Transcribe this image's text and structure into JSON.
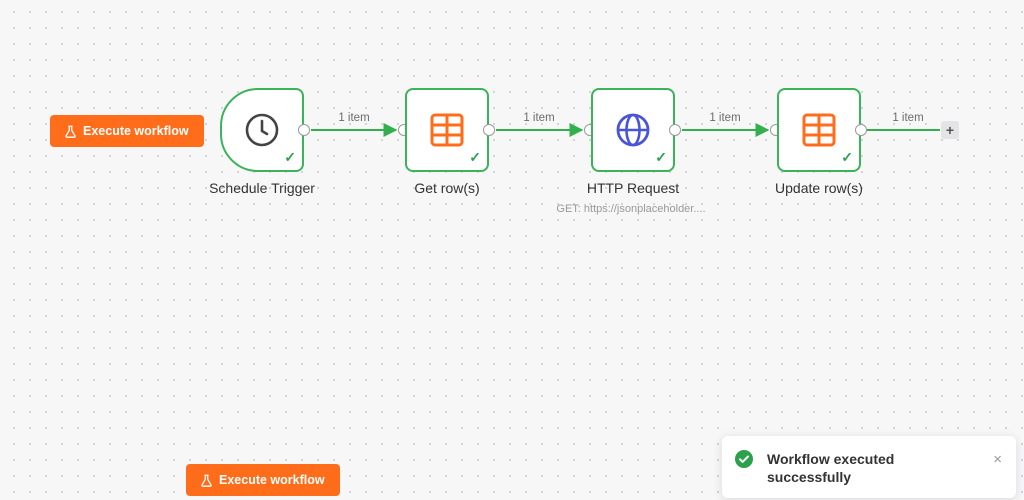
{
  "canvas": {
    "execute_button_label": "Execute workflow",
    "add_node_symbol": "+"
  },
  "connections": [
    {
      "label": "1 item"
    },
    {
      "label": "1 item"
    },
    {
      "label": "1 item"
    },
    {
      "label": "1 item"
    }
  ],
  "nodes": [
    {
      "title": "Schedule Trigger",
      "icon": "clock-icon",
      "subtitle": ""
    },
    {
      "title": "Get row(s)",
      "icon": "table-icon",
      "subtitle": ""
    },
    {
      "title": "HTTP Request",
      "icon": "globe-icon",
      "subtitle": "GET: https://jsonplaceholder...."
    },
    {
      "title": "Update row(s)",
      "icon": "table-icon",
      "subtitle": ""
    }
  ],
  "toast": {
    "message": "Workflow executed successfully",
    "status": "success",
    "close_symbol": "×"
  },
  "colors": {
    "accent": "#ff6d1a",
    "success": "#2aa14a",
    "node_border": "#3ab35a",
    "connector": "#33b04e",
    "globe": "#4a54d9",
    "table": "#ff6d1a"
  }
}
